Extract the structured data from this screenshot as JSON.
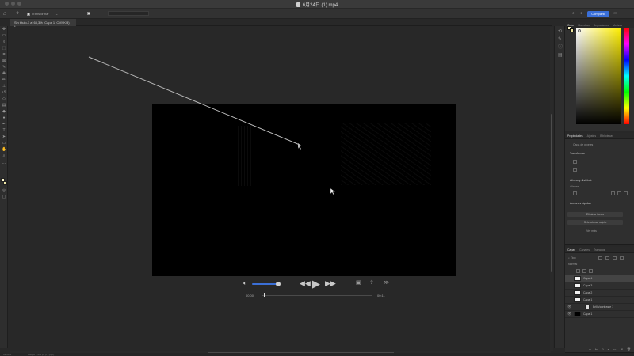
{
  "window": {
    "title": "6月24日 (1).mp4",
    "menus": [
      "",
      "",
      "",
      "",
      "",
      "",
      "",
      "",
      "",
      ""
    ]
  },
  "options_bar": {
    "home_icon": "home-icon",
    "checkbox_label": "Transformar",
    "value_label": "",
    "share_label": "Compartir"
  },
  "document": {
    "tab_title": "Sin título-1 al 63,3% (Capa 1, CMYK/8) *"
  },
  "player": {
    "time_current": "00:00",
    "time_total": "00:11",
    "volume": 0.8,
    "progress": 0.02
  },
  "panels": {
    "color_tabs": [
      "Color",
      "Muestras",
      "Degradados",
      "Motivos"
    ],
    "fg_color": "#fff9c4",
    "bg_color": "#efe59c",
    "properties_tabs": [
      "Propiedades",
      "Ajustes",
      "Bibliotecas"
    ],
    "properties": {
      "layer_type": "Capa de píxeles",
      "transform_head": "Transformar",
      "align_head": "Alinear y distribuir",
      "align_sub": "Alinear:",
      "quick_actions_head": "Acciones rápidas",
      "btn_remove_bg": "Eliminar fondo",
      "btn_select_subject": "Seleccionar sujeto",
      "more": "Ver más"
    },
    "layers_tabs": [
      "Capas",
      "Canales",
      "Trazados"
    ],
    "layers_filter": "Tipo",
    "layers_mode": "Normal",
    "layers": [
      {
        "name": "Capa 4",
        "active": true
      },
      {
        "name": "Capa 3",
        "active": false
      },
      {
        "name": "Capa 2",
        "active": false
      },
      {
        "name": "Capa 1",
        "active": false
      },
      {
        "name": "Brillo/contraste 1",
        "active": false
      },
      {
        "name": "Capa 1",
        "active": false
      }
    ]
  },
  "statusbar": {
    "zoom": "63,33%",
    "doc_info": "800 px x 450 px (72 ppp)"
  },
  "colors": {
    "accent": "#3a6fd8"
  }
}
